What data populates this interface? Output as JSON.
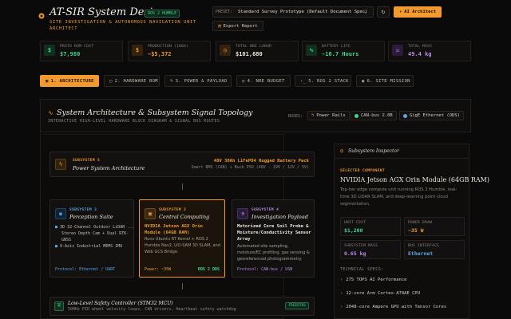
{
  "header": {
    "title": "AT-SIR System Design",
    "version_badge": "ROS 2 HUMBLE",
    "subtitle": "SITE INVESTIGATION & AUTONOMOUS NAVIGATION UNIT ARCHITECT",
    "preset_label": "PRESET:",
    "preset_value": "Standard Survey Prototype (Default Document Spec)",
    "ai_button": "AI Architect",
    "export_button": "Export Report"
  },
  "metrics": [
    {
      "label": "PROTO BOM COST",
      "value": "$7,980",
      "icon": "$",
      "color": "#3dd68c"
    },
    {
      "label": "PRODUCTION (100X)",
      "value": "~$5,372",
      "icon": "$",
      "color": "#f29a2e"
    },
    {
      "label": "TOTAL NRE LABOR",
      "value": "$101,680",
      "icon": "clock",
      "color": "#f29a2e"
    },
    {
      "label": "BATTERY LIFE",
      "value": "~10.7 Hours",
      "icon": "activity",
      "color": "#3dd68c"
    },
    {
      "label": "TOTAL MASS",
      "value": "49.4 kg",
      "icon": "weight",
      "color": "#b88be8"
    }
  ],
  "tabs": [
    {
      "label": "1. ARCHITECTURE",
      "active": true
    },
    {
      "label": "2. HARDWARE BOM",
      "active": false
    },
    {
      "label": "3. POWER & PAYLOAD",
      "active": false
    },
    {
      "label": "4. NRE BUDGET",
      "active": false
    },
    {
      "label": "5. ROS 2 STACK",
      "active": false
    },
    {
      "label": "6. SITE MISSION",
      "active": false
    }
  ],
  "section": {
    "title": "System Architecture & Subsystem Signal Topology",
    "subtitle": "INTERACTIVE HIGH-LEVEL HARDWARE BLOCK DIAGRAM & SIGNAL BUS ROUTES",
    "buses_label": "BUSES:",
    "buses": [
      {
        "label": "Power Rails",
        "color": "#f29a2e"
      },
      {
        "label": "CAN-bus 2.0B",
        "color": "#3dd68c"
      },
      {
        "label": "GigE Ethernet (ODS)",
        "color": "#5aa8e8"
      }
    ]
  },
  "subsystems": {
    "power": {
      "kicker": "SUBSYSTEM 5",
      "name": "Power System Architecture",
      "battery": "48V 30Ah LiFePO4 Rugged Battery Pack",
      "detail": "Smart BMS (CAN) + Buck PSU (48V - 19V / 12V / 5V)"
    },
    "perception": {
      "kicker": "SUBSYSTEM 3",
      "name": "Perception Suite",
      "items": [
        "3D 32-Channel Outdoor LiDAR ...",
        "Stereo Depth Cam + Dual RTK-GNSS",
        "9-Axis Industrial MEMS IMU"
      ],
      "protocol": "Protocol: Ethernet / UART"
    },
    "compute": {
      "kicker": "SUBSYSTEM 2",
      "name": "Central Computing",
      "title": "NVIDIA Jetson AGX Orin Module (64GB RAM)",
      "desc": "Runs Ubuntu RT Kernel + ROS 2 Humble Nav2, LIO-SAM 3D SLAM, and Web GCS Bridge.",
      "power": "Power: ~35W",
      "ros": "ROS 2 DDS"
    },
    "payload": {
      "kicker": "SUBSYSTEM 4",
      "name": "Investigation Payload",
      "title": "Motorized Core Soil Probe & Moisture/Conductivity Sensor Array",
      "desc": "Automated site sampling, moisture/EC profiling, gas sensing & georeferenced photogrammetry.",
      "protocol": "Protocol: CAN-bus / USB"
    },
    "safety": {
      "name": "Low-Level Safety Controller (STM32 MCU)",
      "detail": "500Hz PID wheel velocity loops, CAN drivers, Heartbeat safety watchdog",
      "badge": "FREERTOS"
    }
  },
  "inspector": {
    "title": "Subsystem Inspector",
    "kicker": "SELECTED COMPONENT",
    "name": "NVIDIA Jetson AGX Orin Module (64GB RAM)",
    "desc": "Top-tier edge compute unit running ROS 2 Humble, real-time 3D LiDAR SLAM, and deep-learning point cloud segmentation.",
    "specs": [
      {
        "label": "UNIT COST",
        "value": "$1,200",
        "color": "#3dd68c"
      },
      {
        "label": "POWER DRAW",
        "value": "~35 W",
        "color": "#f29a2e"
      },
      {
        "label": "SUBSYSTEM MASS",
        "value": "0.65 kg",
        "color": "#b88be8"
      },
      {
        "label": "BUS INTERFACE",
        "value": "Ethernet",
        "color": "#5aa8e8"
      }
    ],
    "tech_label": "TECHNICAL SPECS:",
    "tech": [
      "275 TOPS AI Performance",
      "12-core Arm Cortex-A78AE CPU",
      "2048-core Ampere GPU with Tensor Cores"
    ]
  }
}
